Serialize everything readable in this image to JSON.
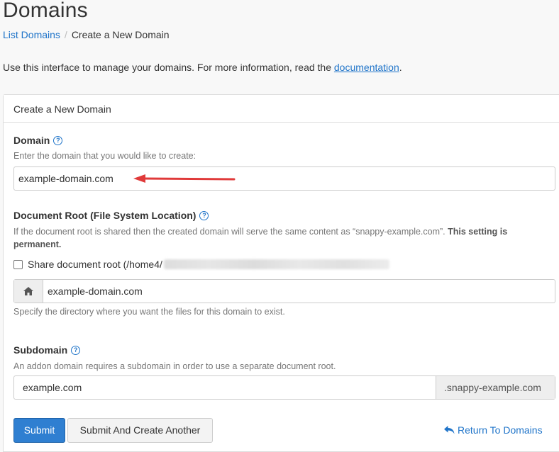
{
  "header": {
    "title": "Domains",
    "breadcrumb": {
      "link": "List Domains",
      "separator": "/",
      "current": "Create a New Domain"
    },
    "intro_text": "Use this interface to manage your domains. For more information, read the ",
    "intro_link": "documentation",
    "intro_end": "."
  },
  "panel": {
    "heading": "Create a New Domain",
    "domain": {
      "label": "Domain",
      "help": "Enter the domain that you would like to create:",
      "value": "example-domain.com"
    },
    "docroot": {
      "label": "Document Root (File System Location)",
      "help_text": "If the document root is shared then the created domain will serve the same content as “snappy-example.com”. ",
      "help_bold": "This setting is permanent.",
      "checkbox_label": "Share document root (/home4/",
      "value": "example-domain.com",
      "help2": "Specify the directory where you want the files for this domain to exist."
    },
    "subdomain": {
      "label": "Subdomain",
      "help": "An addon domain requires a subdomain in order to use a separate document root.",
      "value": "example.com",
      "suffix": ".snappy-example.com"
    },
    "buttons": {
      "submit": "Submit",
      "submit_another": "Submit And Create Another",
      "return": "Return To Domains"
    }
  },
  "colors": {
    "link": "#1f74c9",
    "primary": "#2f7fd1",
    "arrow": "#e03a3a"
  },
  "icons": {
    "help": "question-circle-icon",
    "home": "home-icon",
    "return": "reply-arrow-icon"
  }
}
